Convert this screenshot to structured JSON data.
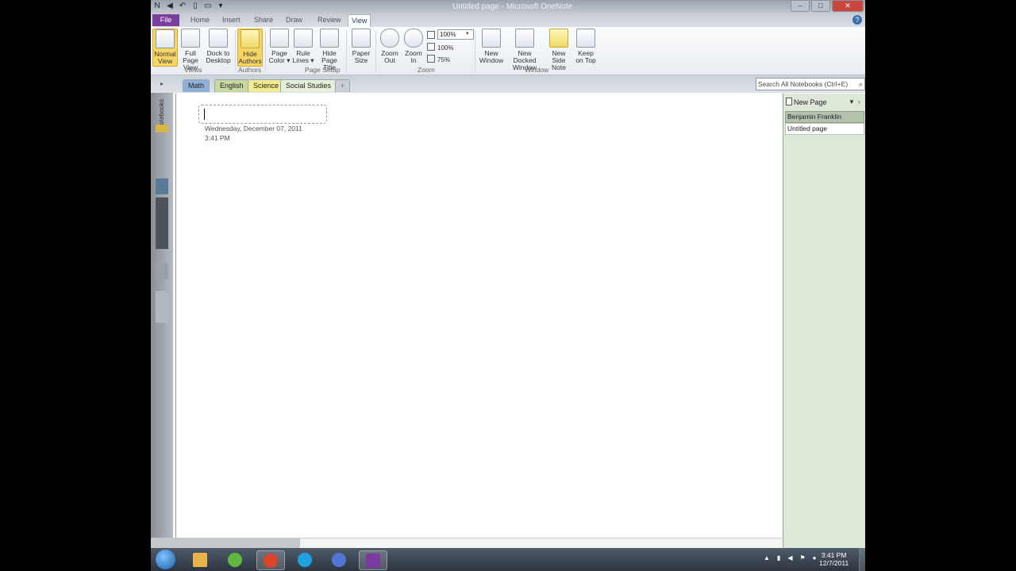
{
  "window": {
    "title": "Untitled page - Microsoft OneNote",
    "minimize": "–",
    "maximize": "□",
    "close": "✕",
    "qat_icons": [
      "onenote-icon",
      "back-icon",
      "undo-icon",
      "dock-icon",
      "full-page-icon",
      "customize-icon"
    ]
  },
  "tabs": {
    "file": "File",
    "home": "Home",
    "insert": "Insert",
    "share": "Share",
    "draw": "Draw",
    "review": "Review",
    "view": "View",
    "help": "?"
  },
  "ribbon": {
    "normal_view": [
      "Normal",
      "View"
    ],
    "full_page_view": [
      "Full Page",
      "View"
    ],
    "dock_to_desktop": [
      "Dock to",
      "Desktop"
    ],
    "hide_authors": [
      "Hide",
      "Authors"
    ],
    "page_color": [
      "Page",
      "Color ▾"
    ],
    "rule_lines": [
      "Rule",
      "Lines ▾"
    ],
    "hide_page_title": [
      "Hide",
      "Page Title"
    ],
    "paper_size": [
      "Paper",
      "Size"
    ],
    "zoom_out": [
      "Zoom",
      "Out"
    ],
    "zoom_in": [
      "Zoom",
      "In"
    ],
    "zoom_value": "100%",
    "zoom_100": "100%",
    "zoom_75": "75%",
    "new_window": [
      "New",
      "Window"
    ],
    "new_docked_window": [
      "New Docked",
      "Window"
    ],
    "new_side_note": [
      "New Side",
      "Note"
    ],
    "keep_on_top": [
      "Keep",
      "on Top"
    ],
    "groups": {
      "views": "Views",
      "authors": "Authors",
      "page_setup": "Page Setup",
      "zoom": "Zoom",
      "window": "Window"
    }
  },
  "sections": {
    "math": "Math",
    "english": "English",
    "science": "Science",
    "social_studies": "Social Studies",
    "new_section": "+"
  },
  "search": {
    "placeholder": "Search All Notebooks (Ctrl+E)"
  },
  "navpane": {
    "label": "Notebooks",
    "toggle": "›"
  },
  "page": {
    "date": "Wednesday, December 07, 2011",
    "time": "3:41 PM"
  },
  "pagelist": {
    "new_page": "New Page",
    "dropdown": "▼",
    "collapse": "›",
    "items": [
      "Benjamin Franklin",
      "Untitled page"
    ]
  },
  "taskbar": {
    "clock_time": "3:41 PM",
    "clock_date": "12/7/2011",
    "tray_arrow": "▲",
    "colors": {
      "explorer": "#e7b54a",
      "spotify": "#5fb83d",
      "chrome": "#d9442b",
      "skype": "#1fa3e0",
      "itunes": "#5176d6",
      "onenote": "#7b3aa0"
    }
  }
}
